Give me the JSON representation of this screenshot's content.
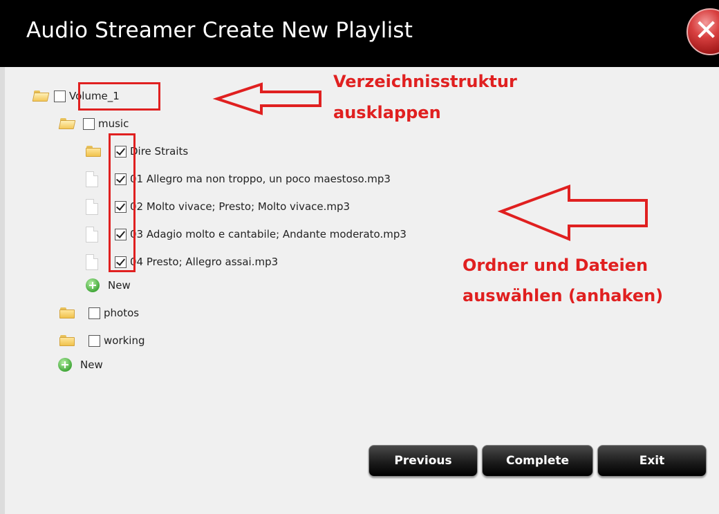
{
  "window": {
    "title": "Audio Streamer Create New Playlist",
    "close_symbol": "✕"
  },
  "tree": {
    "volume": "Volume_1",
    "music": "music",
    "artist": "Dire Straits",
    "files": [
      "01 Allegro ma non troppo, un poco maestoso.mp3",
      "02 Molto vivace; Presto; Molto vivace.mp3",
      "03 Adagio molto e cantabile; Andante moderato.mp3",
      "04 Presto; Allegro assai.mp3"
    ],
    "new_inner": "New",
    "photos": "photos",
    "working": "working",
    "new_outer": "New"
  },
  "checked": {
    "volume": false,
    "music": false,
    "artist": true,
    "files": [
      true,
      true,
      true,
      true
    ],
    "photos": false,
    "working": false
  },
  "annotations": {
    "top_line1": "Verzeichnisstruktur",
    "top_line2": "ausklappen",
    "bottom_line1": "Ordner und Dateien",
    "bottom_line2": "auswählen (anhaken)",
    "color": "#e02020"
  },
  "buttons": {
    "previous": "Previous",
    "complete": "Complete",
    "exit": "Exit"
  },
  "icons": {
    "folder": "folder-icon",
    "file": "file-icon",
    "add": "add-plus-icon",
    "close": "close-icon",
    "arrow": "left-arrow-icon"
  }
}
